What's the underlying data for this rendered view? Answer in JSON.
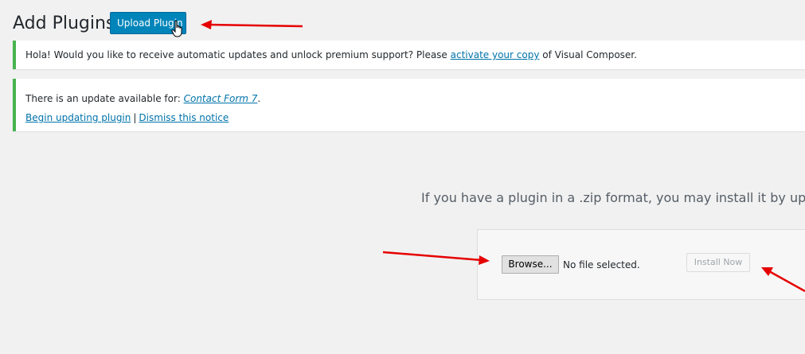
{
  "header": {
    "title": "Add Plugins",
    "upload_button_label": "Upload Plugin"
  },
  "notices": {
    "vc": {
      "text_before": "Hola! Would you like to receive automatic updates and unlock premium support? Please ",
      "link": "activate your copy",
      "text_after": " of Visual Composer."
    },
    "update": {
      "text_before": "There is an update available for: ",
      "plugin_link": "Contact Form 7",
      "text_after": ".",
      "begin_link": "Begin updating plugin",
      "separator": "|",
      "dismiss_link": "Dismiss this notice"
    }
  },
  "upload": {
    "instruction": "If you have a plugin in a .zip format, you may install it by uploadin",
    "browse_label": "Browse...",
    "file_status": "No file selected.",
    "install_label": "Install Now"
  },
  "colors": {
    "accent": "#0085ba",
    "notice_border": "#46b450",
    "link": "#0073aa",
    "annotation_arrow": "#e60000"
  },
  "icons": {
    "cursor": "hand-pointer-icon",
    "arrows": "red-arrow-icon"
  }
}
